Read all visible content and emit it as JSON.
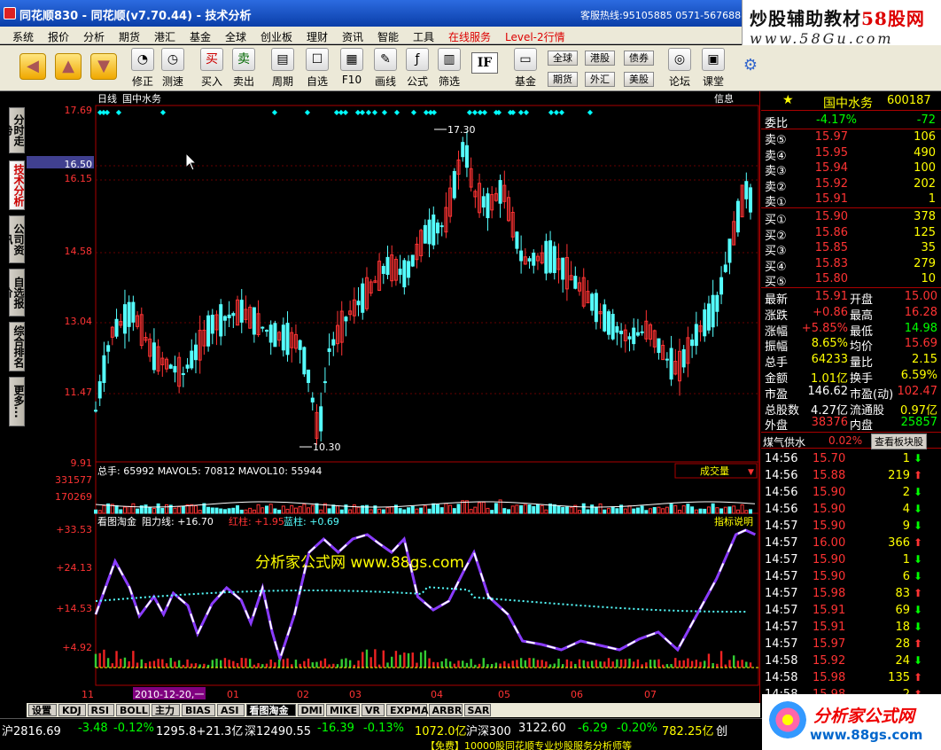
{
  "window": {
    "title": "同花顺830 - 同花顺(v7.70.44) - 技术分析",
    "hotline": "客服热线:95105885 0571-56768888"
  },
  "watermark": {
    "line1a": "炒股辅助教材",
    "line1b": "58股网",
    "line2": "www.58Gu.com"
  },
  "menu": [
    "系统",
    "报价",
    "分析",
    "期货",
    "港汇",
    "基金",
    "全球",
    "创业板",
    "理财",
    "资讯",
    "智能",
    "工具",
    "在线服务",
    "Level-2行情"
  ],
  "toolbar": {
    "buttons": [
      "修正",
      "测速",
      "买入",
      "卖出",
      "周期",
      "自选",
      "F10",
      "画线",
      "公式",
      "筛选",
      "基金",
      "论坛",
      "课堂"
    ],
    "small": [
      "全球",
      "港股",
      "债券",
      "期货",
      "外汇",
      "美股"
    ]
  },
  "left_tabs": [
    "分时走势",
    "技术分析",
    "公司资讯",
    "自选报价",
    "综合排名",
    "更多..."
  ],
  "chart": {
    "period": "日线",
    "stock": "国中水务",
    "info": "信息",
    "y_labels": [
      "17.69",
      "16.50",
      "16.15",
      "14.58",
      "13.04",
      "11.47",
      "9.91"
    ],
    "high_label": "17.30",
    "low_label": "10.30"
  },
  "volume": {
    "header": "总手: 65992  MAVOL5: 70812  MAVOL10: 55944",
    "y_labels": [
      "331577",
      "170269"
    ],
    "selector": "成交量"
  },
  "indicator": {
    "name": "看图淘金",
    "header_parts": [
      "阻力线: +16.70",
      "红柱: +1.95",
      "蓝柱: +0.69"
    ],
    "help": "指标说明",
    "y_labels": [
      "+33.53",
      "+24.13",
      "+14.53",
      "+4.92"
    ],
    "watermark": "分析家公式网 www.88gs.com"
  },
  "x_axis": {
    "labels": [
      "11",
      "2010-12-20,一",
      "01",
      "02",
      "03",
      "04",
      "05",
      "06",
      "07"
    ]
  },
  "bottom_tabs": [
    "设置",
    "KDJ",
    "RSI",
    "BOLL",
    "主力",
    "BIAS",
    "ASI",
    "看图淘金",
    "DMI",
    "MIKE",
    "VR",
    "EXPMA",
    "ARBR",
    "SAR"
  ],
  "quote": {
    "name": "国中水务",
    "code": "600187",
    "webi": {
      "label": "委比",
      "pct": "-4.17%",
      "diff": "-72"
    },
    "sell": [
      {
        "l": "卖⑤",
        "p": "15.97",
        "v": "106"
      },
      {
        "l": "卖④",
        "p": "15.95",
        "v": "490"
      },
      {
        "l": "卖③",
        "p": "15.94",
        "v": "100"
      },
      {
        "l": "卖②",
        "p": "15.92",
        "v": "202"
      },
      {
        "l": "卖①",
        "p": "15.91",
        "v": "1"
      }
    ],
    "buy": [
      {
        "l": "买①",
        "p": "15.90",
        "v": "378"
      },
      {
        "l": "买②",
        "p": "15.86",
        "v": "125"
      },
      {
        "l": "买③",
        "p": "15.85",
        "v": "35"
      },
      {
        "l": "买④",
        "p": "15.83",
        "v": "279"
      },
      {
        "l": "买⑤",
        "p": "15.80",
        "v": "10"
      }
    ],
    "stats": [
      [
        "最新",
        "15.91",
        "开盘",
        "15.00"
      ],
      [
        "涨跌",
        "+0.86",
        "最高",
        "16.28"
      ],
      [
        "涨幅",
        "+5.85%",
        "最低",
        "14.98"
      ],
      [
        "振幅",
        "8.65%",
        "均价",
        "15.69"
      ],
      [
        "总手",
        "64233",
        "量比",
        "2.15"
      ],
      [
        "金额",
        "1.01亿",
        "换手",
        "6.59%"
      ],
      [
        "市盈",
        "146.62",
        "市盈(动)",
        "102.47"
      ],
      [
        "总股数",
        "4.27亿",
        "流通股",
        "0.97亿"
      ],
      [
        "外盘",
        "38376",
        "内盘",
        "25857"
      ]
    ],
    "sector": {
      "name": "煤气供水",
      "pct": "0.02%",
      "btn": "查看板块股"
    },
    "ticks": [
      [
        "14:56",
        "15.70",
        "1",
        "down"
      ],
      [
        "14:56",
        "15.88",
        "219",
        "up"
      ],
      [
        "14:56",
        "15.90",
        "2",
        "down"
      ],
      [
        "14:56",
        "15.90",
        "4",
        "down"
      ],
      [
        "14:57",
        "15.90",
        "9",
        "down"
      ],
      [
        "14:57",
        "16.00",
        "366",
        "up"
      ],
      [
        "14:57",
        "15.90",
        "1",
        "down"
      ],
      [
        "14:57",
        "15.90",
        "6",
        "down"
      ],
      [
        "14:57",
        "15.98",
        "83",
        "up"
      ],
      [
        "14:57",
        "15.91",
        "69",
        "down"
      ],
      [
        "14:57",
        "15.91",
        "18",
        "down"
      ],
      [
        "14:57",
        "15.97",
        "28",
        "up"
      ],
      [
        "14:58",
        "15.92",
        "24",
        "down"
      ],
      [
        "14:58",
        "15.98",
        "135",
        "up"
      ],
      [
        "14:58",
        "15.98",
        "2",
        "up"
      ]
    ]
  },
  "status": {
    "sh": "沪2816.69",
    "sh_chg": "-3.48",
    "sh_pct": "-0.12%",
    "sh_amt": "1295.8+21.3亿",
    "sz": "深12490.55",
    "sz_chg": "-16.39",
    "sz_pct": "-0.13%",
    "sz_amt": "1072.0亿",
    "hs": "沪深300",
    "hs_val": "3122.60",
    "hs_chg": "-6.29",
    "hs_pct": "-0.20%",
    "hs_amt": "782.25亿",
    "cy": "创",
    "ticker": "【免费】10000股同花顺专业炒股服务分析师等"
  },
  "brand": {
    "line1": "分析家公式网",
    "line2": "www.88gs.com"
  }
}
